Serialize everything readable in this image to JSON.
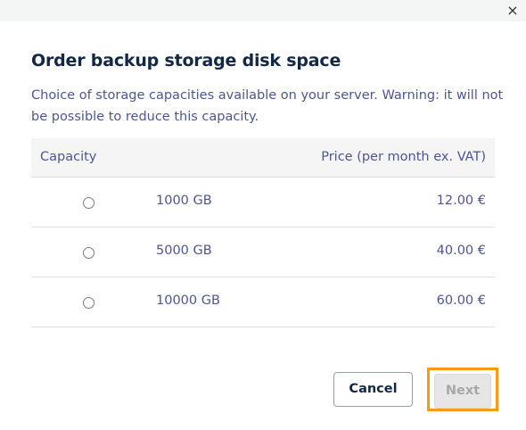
{
  "dialog": {
    "close_icon": "×",
    "title": "Order backup storage disk space",
    "description": "Choice of storage capacities available on your server. Warning: it will not be possible to reduce this capacity."
  },
  "table": {
    "headers": {
      "capacity": "Capacity",
      "price": "Price (per month ex. VAT)"
    },
    "rows": [
      {
        "capacity": "1000 GB",
        "price": "12.00 €",
        "selected": false
      },
      {
        "capacity": "5000 GB",
        "price": "40.00 €",
        "selected": false
      },
      {
        "capacity": "10000 GB",
        "price": "60.00 €",
        "selected": false
      }
    ]
  },
  "buttons": {
    "cancel": "Cancel",
    "next": "Next",
    "next_disabled": true
  },
  "colors": {
    "title": "#122844",
    "text": "#4d5693",
    "highlight": "#f59b16"
  }
}
